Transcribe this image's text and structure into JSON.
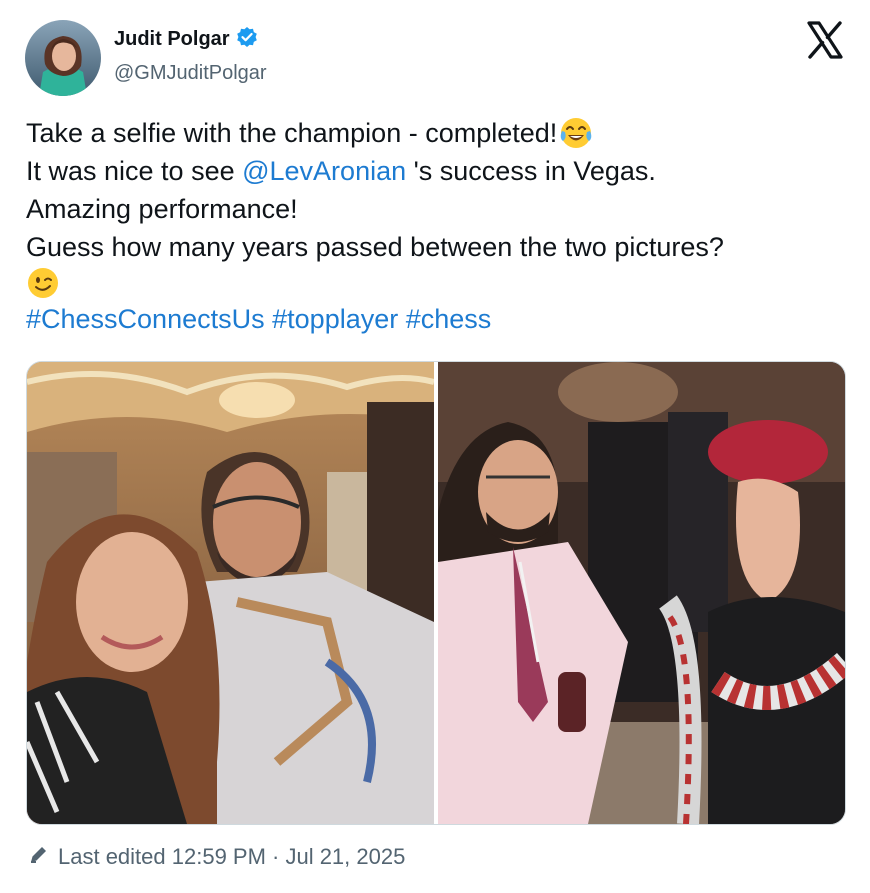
{
  "author": {
    "display_name": "Judit Polgar",
    "handle": "@GMJuditPolgar",
    "verified": true
  },
  "icons": {
    "verified": "verified-badge-icon",
    "platform": "x-logo-icon",
    "edit": "pencil-icon",
    "emoji_laugh": "face-with-tears-of-joy-icon",
    "emoji_wink": "winking-face-icon"
  },
  "tweet": {
    "line1": "Take a selfie with the champion - completed!",
    "line2_pre": "It was nice to see ",
    "line2_mention": "@LevAronian",
    "line2_post": " 's success in Vegas.",
    "line3": "Amazing performance!",
    "line4": "Guess how many years passed between the two pictures?",
    "hashtags": [
      "#ChessConnectsUs",
      "#topplayer",
      "#chess"
    ]
  },
  "media": {
    "count": 2
  },
  "footer": {
    "edited_text": "Last edited 12:59 PM · Jul 21, 2025"
  },
  "colors": {
    "link": "#1d7bd1",
    "verified": "#1d9bf0",
    "secondary_text": "#536471"
  }
}
